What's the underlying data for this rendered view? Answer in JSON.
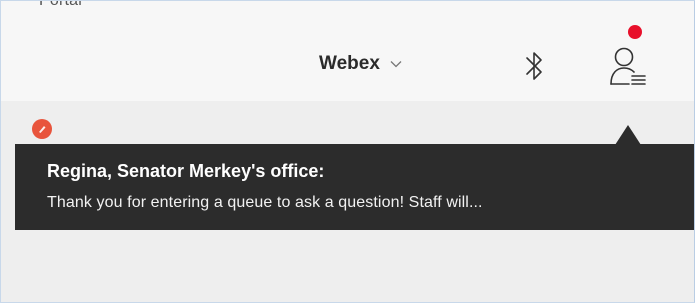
{
  "header": {
    "clipped_top_text": "Portal",
    "app_name": "Webex",
    "icons": {
      "app_chevron": "chevron-down-icon",
      "bluetooth": "bluetooth-icon",
      "profile": "profile-menu-icon",
      "notification": "notification-dot"
    },
    "colors": {
      "notification_dot": "#e8102b",
      "background": "#f7f7f7"
    }
  },
  "notification": {
    "title": "Regina, Senator Merkey's office:",
    "message": "Thank you for entering a queue to ask a question! Staff will...",
    "badge_icon": "status-badge-icon",
    "colors": {
      "background": "#2c2c2c",
      "badge": "#e8543c",
      "text": "#ffffff"
    }
  }
}
